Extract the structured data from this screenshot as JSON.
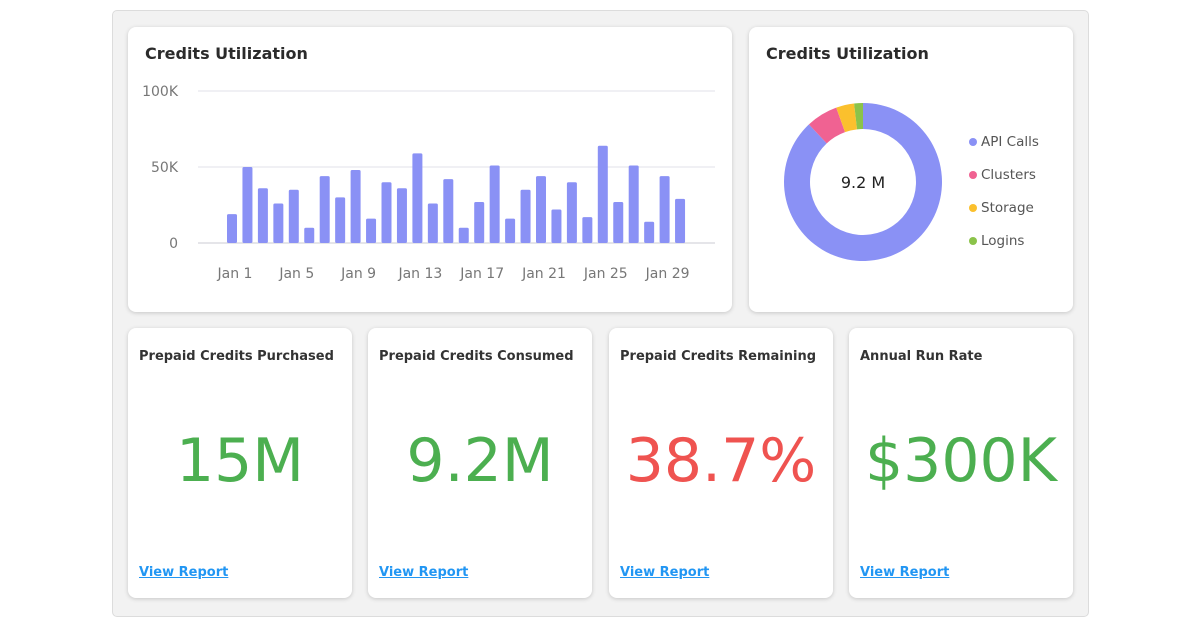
{
  "bar_card": {
    "title": "Credits Utilization"
  },
  "donut_card": {
    "title": "Credits Utilization",
    "center_label": "9.2 M"
  },
  "chart_data": [
    {
      "type": "bar",
      "title": "Credits Utilization",
      "xlabel": "",
      "ylabel": "",
      "ylim": [
        0,
        100000
      ],
      "yticks": [
        0,
        50000,
        100000
      ],
      "ytick_labels": [
        "0",
        "50K",
        "100K"
      ],
      "grid": true,
      "color": "#8a91f5",
      "categories": [
        "Jan 1",
        "Jan 2",
        "Jan 3",
        "Jan 4",
        "Jan 5",
        "Jan 6",
        "Jan 7",
        "Jan 8",
        "Jan 9",
        "Jan 10",
        "Jan 11",
        "Jan 12",
        "Jan 13",
        "Jan 14",
        "Jan 15",
        "Jan 16",
        "Jan 17",
        "Jan 18",
        "Jan 19",
        "Jan 20",
        "Jan 21",
        "Jan 22",
        "Jan 23",
        "Jan 24",
        "Jan 25",
        "Jan 26",
        "Jan 27",
        "Jan 28",
        "Jan 29",
        "Jan 30"
      ],
      "xtick_labels": [
        "Jan 1",
        "Jan 5",
        "Jan 9",
        "Jan 13",
        "Jan 17",
        "Jan 21",
        "Jan 25",
        "Jan 29"
      ],
      "values": [
        19000,
        50000,
        36000,
        26000,
        35000,
        10000,
        44000,
        30000,
        48000,
        16000,
        40000,
        36000,
        59000,
        26000,
        42000,
        10000,
        27000,
        51000,
        16000,
        35000,
        44000,
        22000,
        40000,
        17000,
        64000,
        27000,
        51000,
        14000,
        44000,
        29000
      ]
    },
    {
      "type": "pie",
      "title": "Credits Utilization",
      "donut": true,
      "center_label": "9.2 M",
      "legend_position": "right",
      "labels": [
        "API Calls",
        "Clusters",
        "Storage",
        "Logins"
      ],
      "values": [
        88,
        6.5,
        3.7,
        1.8
      ],
      "colors": [
        "#8a91f5",
        "#f06292",
        "#fbc02d",
        "#8bc34a"
      ]
    }
  ],
  "kpis": [
    {
      "title": "Prepaid Credits Purchased",
      "value": "15M",
      "color": "#4caf50",
      "link": "View Report"
    },
    {
      "title": "Prepaid Credits Consumed",
      "value": "9.2M",
      "color": "#4caf50",
      "link": "View Report"
    },
    {
      "title": "Prepaid Credits Remaining",
      "value": "38.7%",
      "color": "#ef5350",
      "link": "View Report"
    },
    {
      "title": "Annual Run Rate",
      "value": "$300K",
      "color": "#4caf50",
      "link": "View Report"
    }
  ]
}
